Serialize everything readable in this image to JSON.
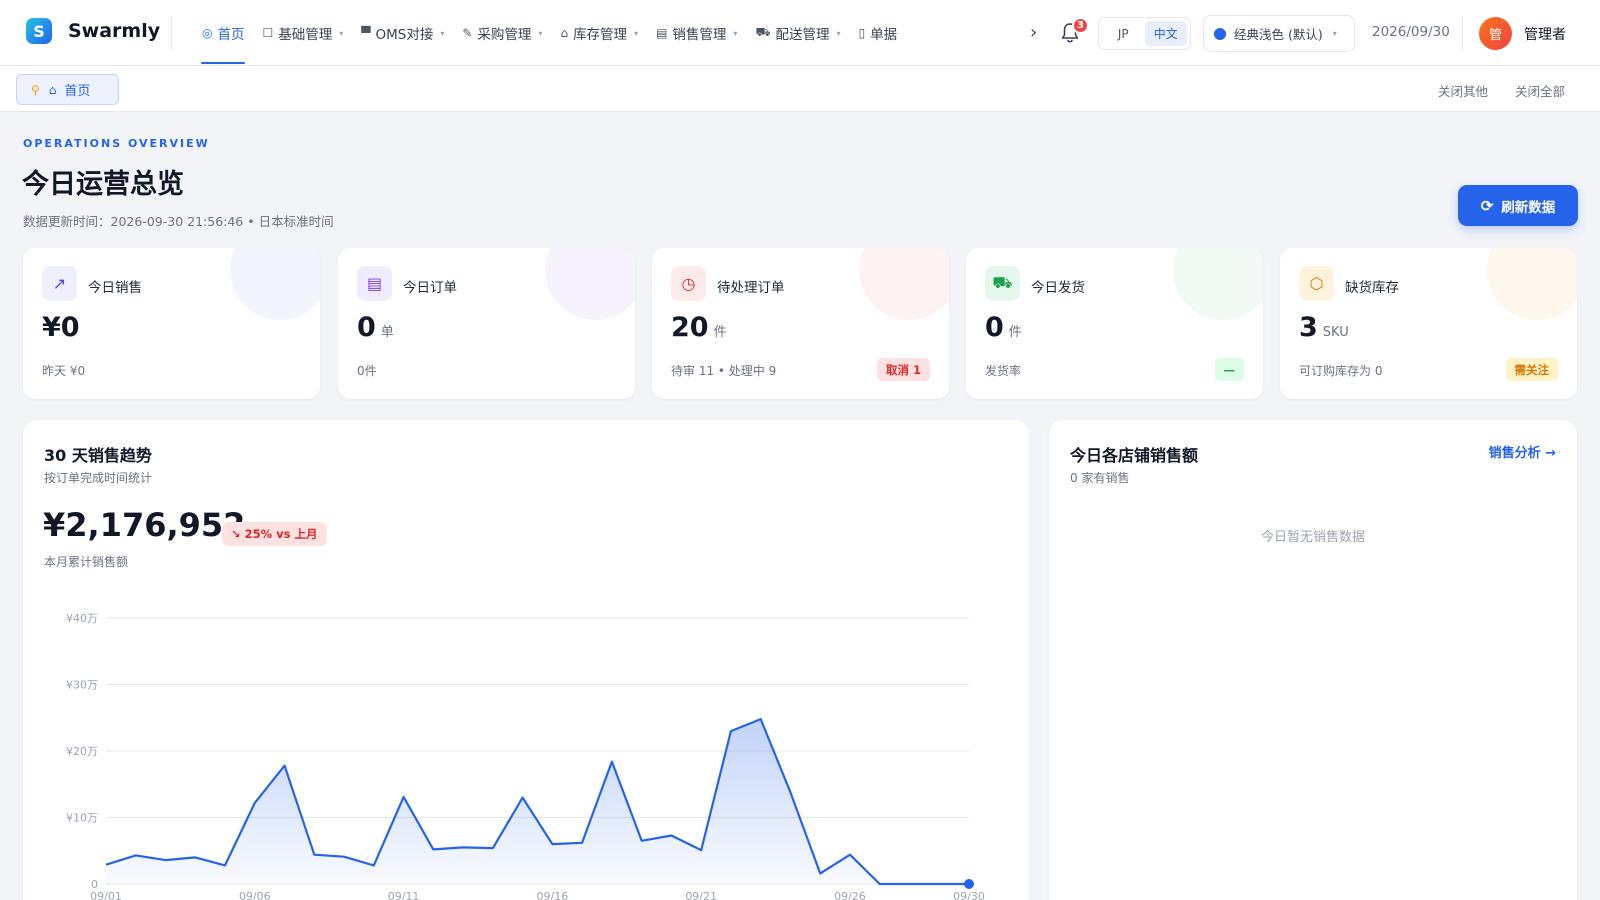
{
  "app": {
    "name": "Swarmly",
    "logo_letter": "S"
  },
  "nav": {
    "items": [
      {
        "label": "首页",
        "icon": "dashboard-icon",
        "glyph": "◎",
        "active": true,
        "caret": false
      },
      {
        "label": "基础管理",
        "icon": "box-icon",
        "glyph": "☐",
        "active": false,
        "caret": true
      },
      {
        "label": "OMS对接",
        "icon": "store-icon",
        "glyph": "▀",
        "active": false,
        "caret": true
      },
      {
        "label": "采购管理",
        "icon": "pen-icon",
        "glyph": "✎",
        "active": false,
        "caret": true
      },
      {
        "label": "库存管理",
        "icon": "warehouse-icon",
        "glyph": "⌂",
        "active": false,
        "caret": true
      },
      {
        "label": "销售管理",
        "icon": "document-icon",
        "glyph": "▤",
        "active": false,
        "caret": true
      },
      {
        "label": "配送管理",
        "icon": "truck-icon",
        "glyph": "⛟",
        "active": false,
        "caret": true
      },
      {
        "label": "单据",
        "icon": "book-icon",
        "glyph": "▯",
        "active": false,
        "caret": false
      }
    ],
    "more_glyph": "›",
    "notification_count": "3",
    "languages": [
      "JP",
      "中文"
    ],
    "active_language": "中文",
    "theme_label": "经典浅色 (默认)",
    "date": "2026/09/30",
    "user": {
      "avatar_text": "管",
      "name": "管理者"
    }
  },
  "tabs": {
    "open": [
      {
        "label": "首页"
      }
    ],
    "close_others": "关闭其他",
    "close_all": "关闭全部"
  },
  "header": {
    "eyebrow": "OPERATIONS OVERVIEW",
    "title": "今日运营总览",
    "updated": "数据更新时间：2026-09-30 21:56:46 • 日本标准时间",
    "refresh_label": "刷新数据"
  },
  "stats": [
    {
      "key": "sales",
      "label": "今日销售",
      "value": "¥0",
      "unit": "",
      "sub": "昨天 ¥0",
      "pill": "",
      "icon": "trend-up-icon",
      "glyph": "↗",
      "color": "#4f46e5",
      "tint": "#eef0fe",
      "blob": "#e7ebfb"
    },
    {
      "key": "orders",
      "label": "今日订单",
      "value": "0",
      "unit": "单",
      "sub": "0件",
      "pill": "",
      "icon": "clipboard-icon",
      "glyph": "▤",
      "color": "#7c3aed",
      "tint": "#f1ecfd",
      "blob": "#ede7fb"
    },
    {
      "key": "pending",
      "label": "待处理订单",
      "value": "20",
      "unit": "件",
      "sub": "待审 11 • 处理中 9",
      "pill": "取消 1",
      "pill_fg": "#dc2626",
      "pill_bg": "#fee2e2",
      "icon": "clock-icon",
      "glyph": "◷",
      "color": "#dc2626",
      "tint": "#fdeaea",
      "blob": "#fde7e7"
    },
    {
      "key": "shipped",
      "label": "今日发货",
      "value": "0",
      "unit": "件",
      "sub": "发货率",
      "pill": "—",
      "pill_fg": "#16a34a",
      "pill_bg": "#dcfce7",
      "icon": "truck-icon",
      "glyph": "⛟",
      "color": "#16a34a",
      "tint": "#e5f7ec",
      "blob": "#e3f6ea"
    },
    {
      "key": "stockout",
      "label": "缺货库存",
      "value": "3",
      "unit": "SKU",
      "sub": "可订购库存为 0",
      "pill": "需关注",
      "pill_fg": "#d97706",
      "pill_bg": "#fef3c7",
      "icon": "package-icon",
      "glyph": "⬡",
      "color": "#d97706",
      "tint": "#fdf3dd",
      "blob": "#fcf0dc"
    }
  ],
  "trend": {
    "title": "30 天销售趋势",
    "subtitle": "按订单完成时间统计",
    "amount": "¥2,176,952",
    "delta": "↘ 25% vs 上月",
    "amount_label": "本月累计销售额"
  },
  "stores": {
    "title": "今日各店铺销售额",
    "subtitle": "0 家有销售",
    "link": "销售分析 →",
    "empty": "今日暂无销售数据"
  },
  "chart_data": {
    "type": "area",
    "x": [
      "09/01",
      "09/02",
      "09/03",
      "09/04",
      "09/05",
      "09/06",
      "09/07",
      "09/08",
      "09/09",
      "09/10",
      "09/11",
      "09/12",
      "09/13",
      "09/14",
      "09/15",
      "09/16",
      "09/17",
      "09/18",
      "09/19",
      "09/20",
      "09/21",
      "09/22",
      "09/23",
      "09/24",
      "09/25",
      "09/26",
      "09/27",
      "09/28",
      "09/29",
      "09/30"
    ],
    "xticks": [
      "09/01",
      "09/06",
      "09/11",
      "09/16",
      "09/21",
      "09/26",
      "09/30"
    ],
    "values": [
      29000,
      43000,
      36000,
      40000,
      28000,
      122000,
      178000,
      44000,
      41000,
      28000,
      131000,
      52000,
      55000,
      54000,
      130000,
      60000,
      62000,
      184000,
      65000,
      73000,
      51000,
      230000,
      248000,
      138000,
      16000,
      44000,
      0,
      0,
      0,
      0
    ],
    "ylim": [
      0,
      400000
    ],
    "yticks": [
      0,
      100000,
      200000,
      300000,
      400000
    ],
    "ytick_labels": [
      "0",
      "¥10万",
      "¥20万",
      "¥30万",
      "¥40万"
    ],
    "grid": true,
    "color": "#2563eb"
  }
}
